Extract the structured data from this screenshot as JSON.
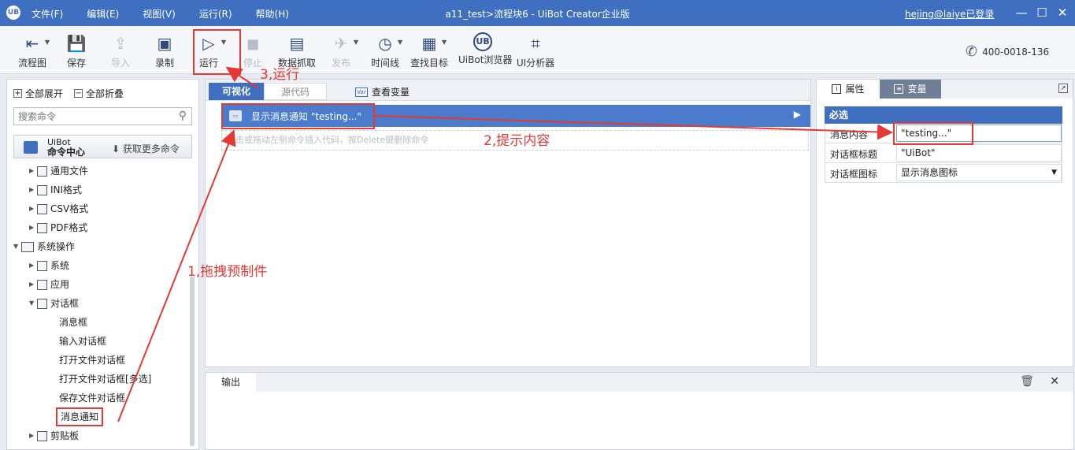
{
  "titlebar": {
    "logo": "UB",
    "menu": [
      "文件(F)",
      "编辑(E)",
      "视图(V)",
      "运行(R)",
      "帮助(H)"
    ],
    "title": "a11_test>流程块6 - UiBot Creator企业版",
    "user": "hejing@laiye已登录",
    "minimize": "—",
    "maximize": "☐",
    "close": "✕"
  },
  "toolbar": {
    "tools": [
      {
        "label": "流程图",
        "icon": "flowchart-icon",
        "glyph": "⇤"
      },
      {
        "label": "保存",
        "icon": "save-icon",
        "glyph": "💾"
      },
      {
        "label": "导入",
        "icon": "import-icon",
        "glyph": "⇪"
      },
      {
        "label": "录制",
        "icon": "record-icon",
        "glyph": "▣"
      },
      {
        "label": "运行",
        "icon": "run-icon",
        "glyph": "▷"
      },
      {
        "label": "停止",
        "icon": "stop-icon",
        "glyph": "◼"
      },
      {
        "label": "数据抓取",
        "icon": "data-scrape-icon",
        "glyph": "▤"
      },
      {
        "label": "发布",
        "icon": "publish-icon",
        "glyph": "✈"
      },
      {
        "label": "时间线",
        "icon": "timeline-icon",
        "glyph": "◷"
      },
      {
        "label": "查找目标",
        "icon": "find-target-icon",
        "glyph": "▦"
      },
      {
        "label": "UiBot浏览器",
        "icon": "uibot-browser-icon",
        "glyph": "UB"
      },
      {
        "label": "UI分析器",
        "icon": "ui-analyzer-icon",
        "glyph": "⌗"
      }
    ],
    "phone": "400-0018-136"
  },
  "leftpanel": {
    "expand_all": "全部展开",
    "collapse_all": "全部折叠",
    "search_placeholder": "搜索命令",
    "cmd_center_line1": "UiBot",
    "cmd_center_line2": "命令中心",
    "get_more": "⬇ 获取更多命令",
    "tree": [
      {
        "label": "通用文件",
        "level": 2,
        "arrow": "▶",
        "icon": "file-icon"
      },
      {
        "label": "INI格式",
        "level": 2,
        "arrow": "▶",
        "icon": "ini-file-icon"
      },
      {
        "label": "CSV格式",
        "level": 2,
        "arrow": "▶",
        "icon": "csv-file-icon"
      },
      {
        "label": "PDF格式",
        "level": 2,
        "arrow": "▶",
        "icon": "pdf-file-icon"
      },
      {
        "label": "系统操作",
        "level": 1,
        "arrow": "▼",
        "icon": "system-ops-icon"
      },
      {
        "label": "系统",
        "level": 2,
        "arrow": "▶",
        "icon": "system-icon"
      },
      {
        "label": "应用",
        "level": 2,
        "arrow": "▶",
        "icon": "app-icon"
      },
      {
        "label": "对话框",
        "level": 2,
        "arrow": "▼",
        "icon": "dialog-icon"
      },
      {
        "label": "消息框",
        "level": 3
      },
      {
        "label": "输入对话框",
        "level": 3
      },
      {
        "label": "打开文件对话框",
        "level": 3
      },
      {
        "label": "打开文件对话框[多选]",
        "level": 3
      },
      {
        "label": "保存文件对话框",
        "level": 3
      },
      {
        "label": "消息通知",
        "level": 3,
        "highlight": true
      },
      {
        "label": "剪贴板",
        "level": 2,
        "arrow": "▶",
        "icon": "clipboard-icon"
      }
    ]
  },
  "editor": {
    "tab_visual": "可视化",
    "tab_source": "源代码",
    "view_vars": "查看变量",
    "command_text": "显示消息通知 \"testing...\"",
    "hint": "点击或拖动左侧命令插入代码，按Delete键删除命令"
  },
  "output": {
    "tab": "输出"
  },
  "properties": {
    "tab_props": "属性",
    "tab_vars": "变量",
    "required": "必选",
    "rows": [
      {
        "label": "消息内容",
        "value": "\"testing...\""
      },
      {
        "label": "对话框标题",
        "value": "\"UiBot\""
      },
      {
        "label": "对话框图标",
        "value": "显示消息图标"
      }
    ]
  },
  "annotations": {
    "step1": "1,拖拽预制件",
    "step2": "2,提示内容",
    "step3": "3,运行"
  },
  "colors": {
    "accent": "#3f6fc0",
    "annotation": "#e53935"
  }
}
